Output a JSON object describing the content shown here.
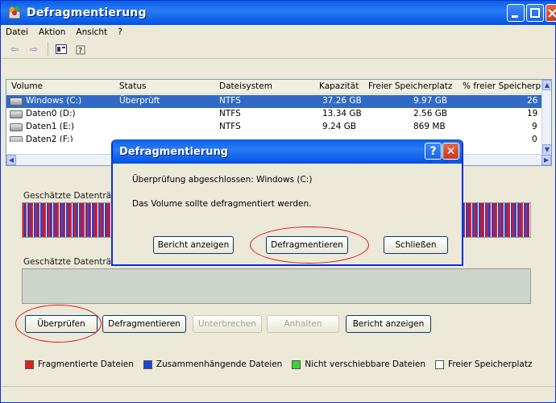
{
  "window": {
    "title": "Defragmentierung"
  },
  "menu": [
    "Datei",
    "Aktion",
    "Ansicht",
    "?"
  ],
  "toolbar_icons": [
    "back-arrow-icon",
    "forward-arrow-icon",
    "properties-icon",
    "help-icon"
  ],
  "volume_list": {
    "columns": [
      "Volume",
      "Status",
      "Dateisystem",
      "Kapazität",
      "Freier Speicherplatz",
      "% freier Speicherpla"
    ],
    "rows": [
      {
        "volume": "Windows (C:)",
        "status": "Überprüft",
        "fs": "NTFS",
        "capacity": "37.26 GB",
        "free": "9.97 GB",
        "pct": "26",
        "selected": true
      },
      {
        "volume": "Daten0 (D:)",
        "status": "",
        "fs": "NTFS",
        "capacity": "13.34 GB",
        "free": "2.56 GB",
        "pct": "19",
        "selected": false
      },
      {
        "volume": "Daten1 (E:)",
        "status": "",
        "fs": "NTFS",
        "capacity": "9.24 GB",
        "free": "869 MB",
        "pct": "9",
        "selected": false
      },
      {
        "volume": "Daten2 (F:)",
        "status": "",
        "fs": "",
        "capacity": "",
        "free": "",
        "pct": "0",
        "selected": false
      }
    ]
  },
  "sections": {
    "before_label": "Geschätzte Datenträg",
    "after_label": "Geschätzte Datenträg"
  },
  "buttons": {
    "check": "Überprüfen",
    "defrag": "Defragmentieren",
    "pause": "Unterbrechen",
    "stop": "Anhalten",
    "report": "Bericht anzeigen"
  },
  "legend": [
    {
      "label": "Fragmentierte Dateien",
      "color": "#e02020"
    },
    {
      "label": "Zusammenhängende Dateien",
      "color": "#1a44d6"
    },
    {
      "label": "Nicht verschiebbare Dateien",
      "color": "#3ad23a"
    },
    {
      "label": "Freier Speicherplatz",
      "color": "#ffffff"
    }
  ],
  "dialog": {
    "title": "Defragmentierung",
    "line1": "Überprüfung abgeschlossen: Windows (C:)",
    "line2": "Das Volume sollte defragmentiert werden.",
    "report": "Bericht anzeigen",
    "defrag": "Defragmentieren",
    "close": "Schließen",
    "help": "?",
    "x": "✕"
  },
  "colors": {
    "accent": "#0a5fe6",
    "highlight_ring": "#d21a1a",
    "selection": "#316ac5"
  }
}
